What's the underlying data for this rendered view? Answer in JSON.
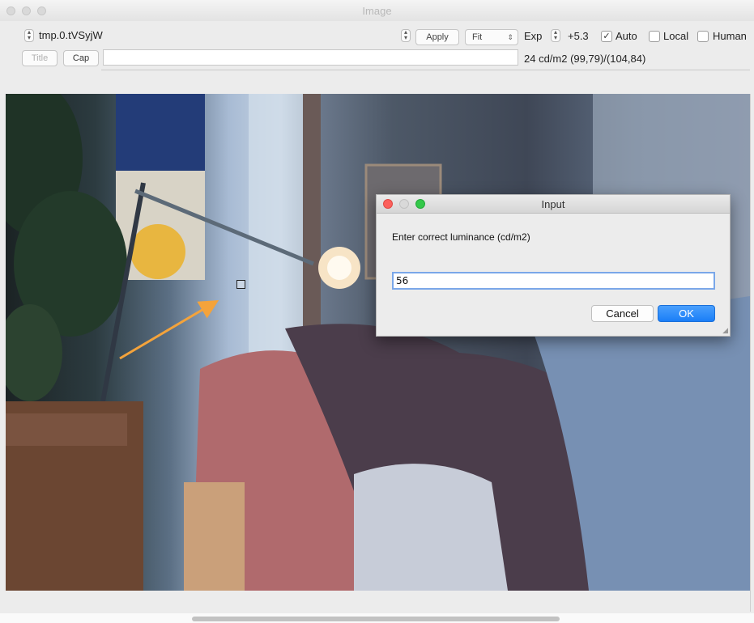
{
  "window": {
    "title": "Image"
  },
  "toolbar": {
    "file_name": "tmp.0.tVSyjW",
    "apply_label": "Apply",
    "fit_value": "Fit",
    "exp_label": "Exp",
    "exp_value": "+5.3",
    "auto_label": "Auto",
    "auto_checked": true,
    "local_label": "Local",
    "local_checked": false,
    "human_label": "Human",
    "human_checked": false,
    "title_button": "Title",
    "cap_button": "Cap",
    "caption_value": "",
    "status": "24 cd/m2 (99,79)/(104,84)"
  },
  "dialog": {
    "title": "Input",
    "prompt": "Enter correct luminance (cd/m2)",
    "input_value": "56",
    "cancel_label": "Cancel",
    "ok_label": "OK"
  },
  "colors": {
    "accent_button": "#1a82fb",
    "arrow": "#f4a33b",
    "close_dot": "#fc605c",
    "minimize_dot": "#d9d9d9",
    "zoom_dot": "#34c84a"
  }
}
